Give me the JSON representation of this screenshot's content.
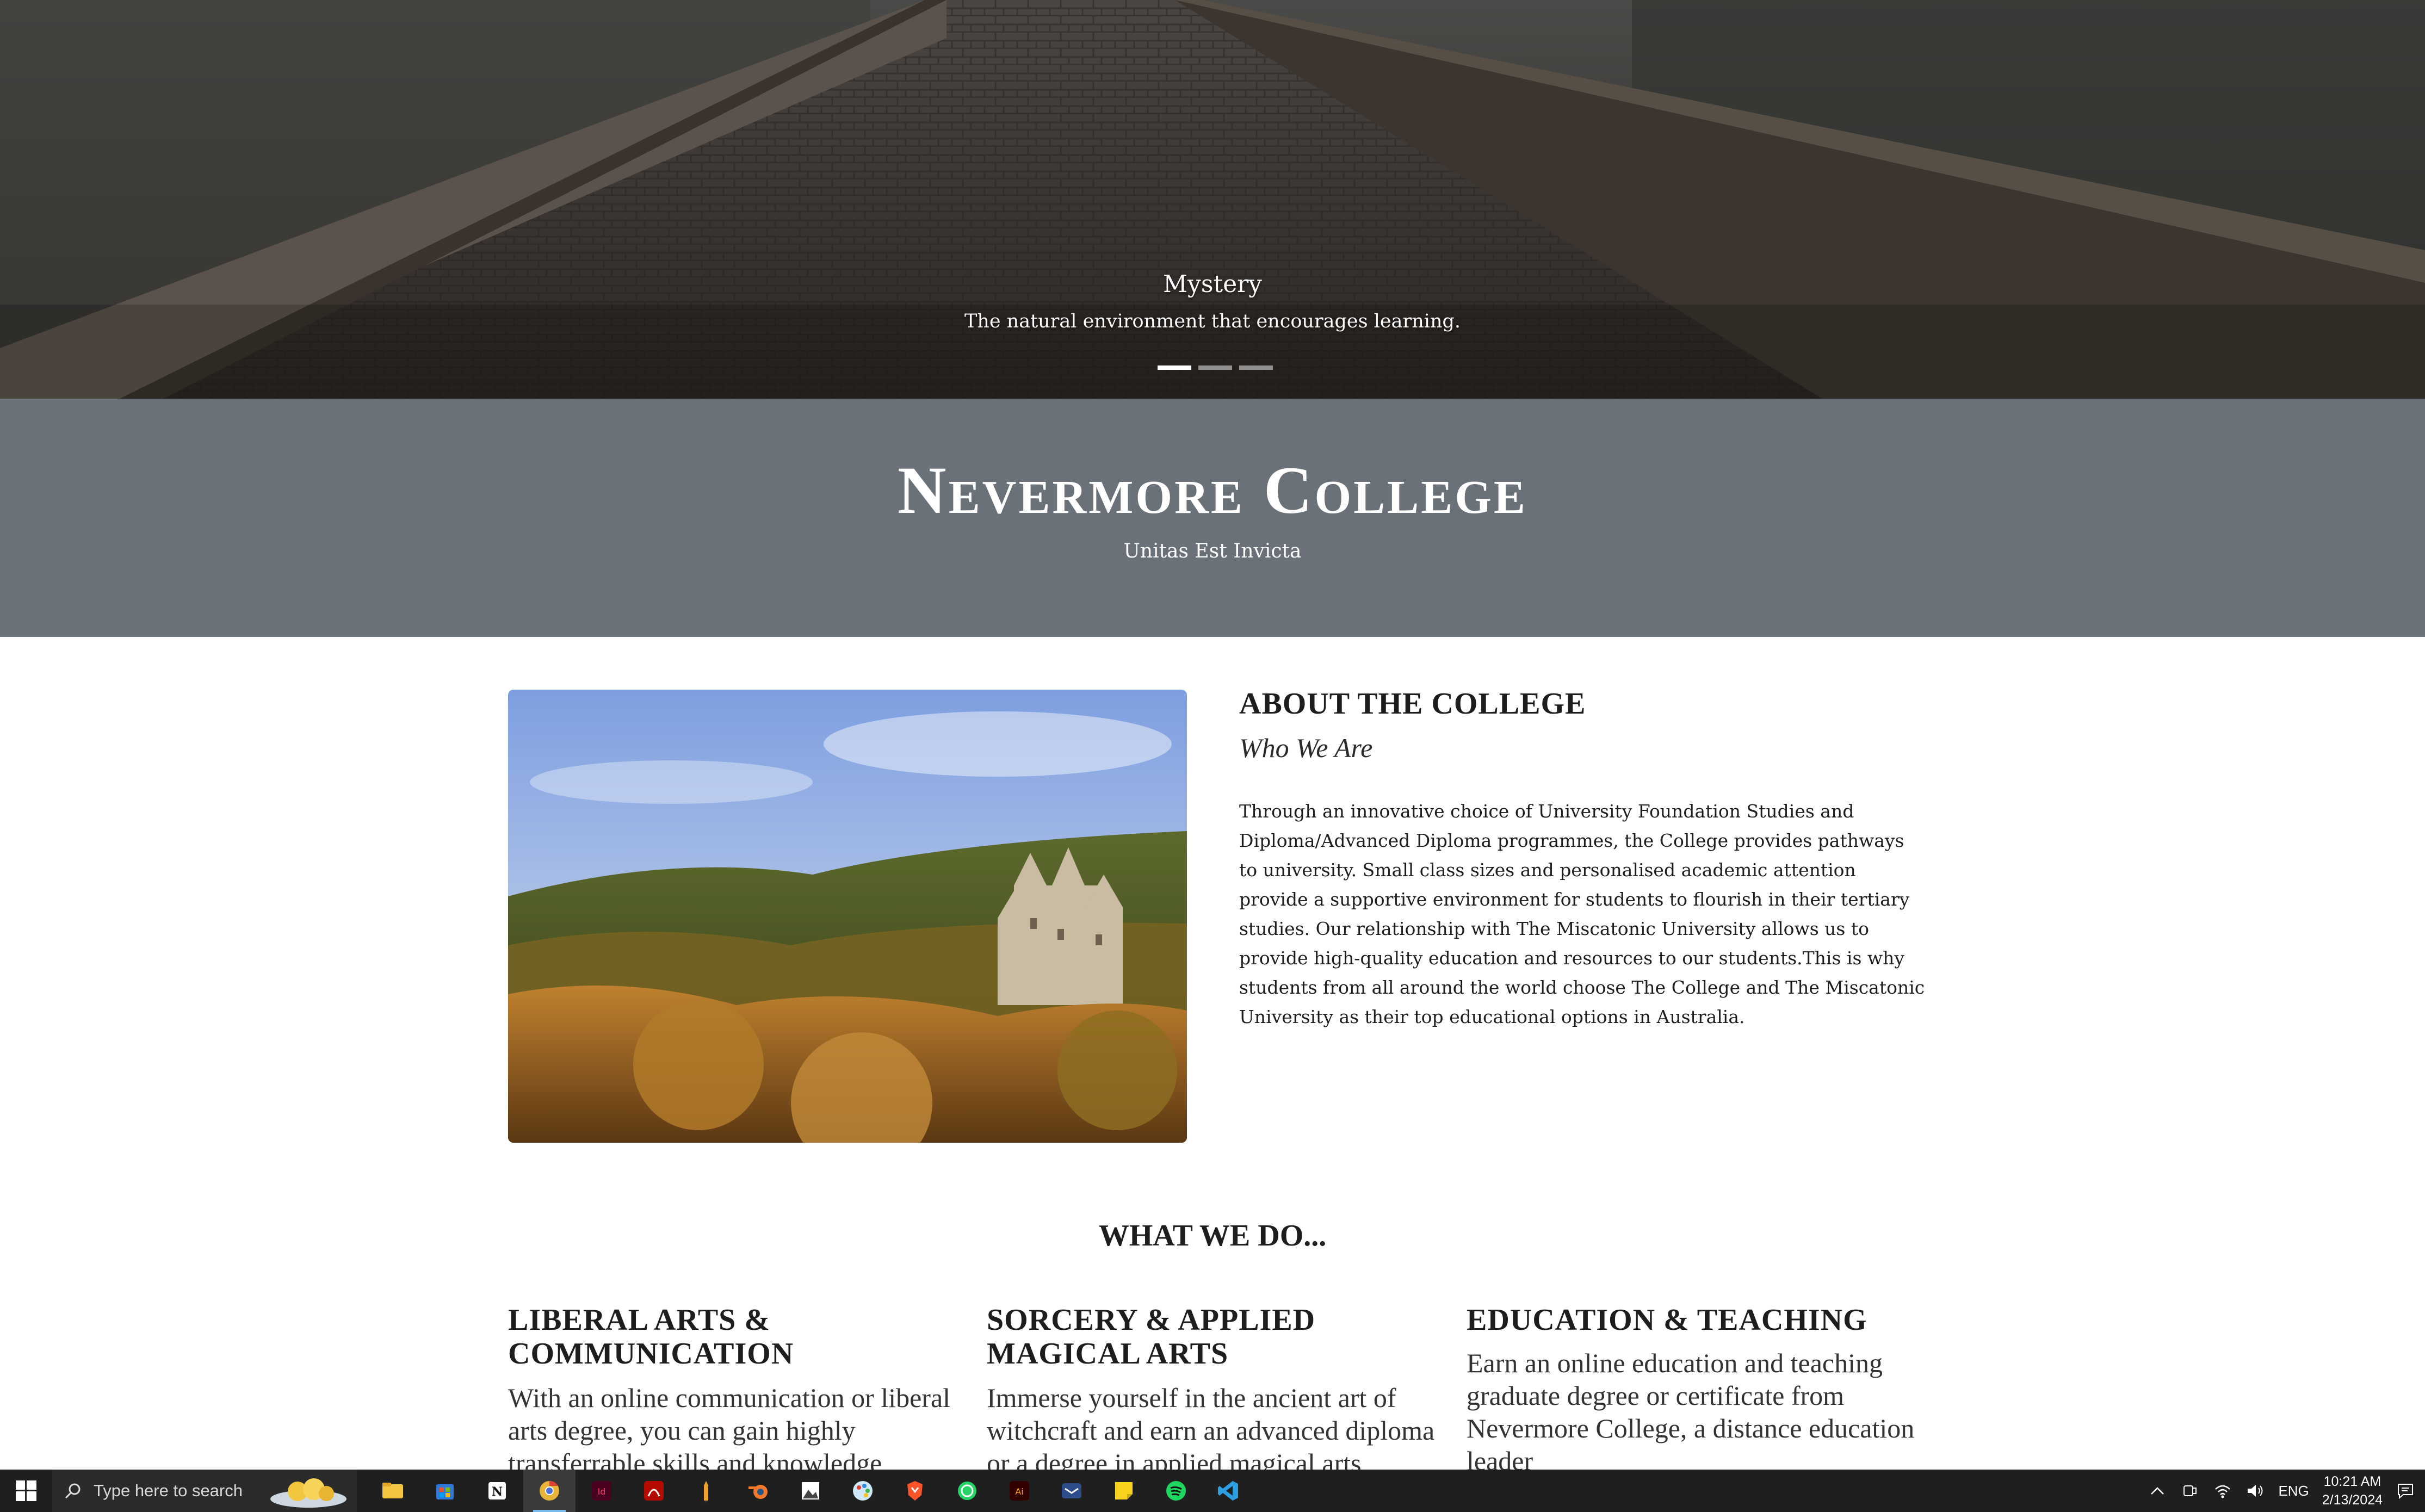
{
  "hero": {
    "title": "Mystery",
    "subtitle": "The natural environment that encourages learning.",
    "active_slide": 1,
    "slide_count": 3
  },
  "band": {
    "college_name": "Nevermore College",
    "motto": "Unitas Est Invicta"
  },
  "about": {
    "heading": "ABOUT THE COLLEGE",
    "subheading": "Who We Are",
    "body": "Through an innovative choice of University Foundation Studies and Diploma/Advanced Diploma programmes, the College provides pathways to university. Small class sizes and personalised academic attention provide a supportive environment for students to flourish in their tertiary studies. Our relationship with The Miscatonic University allows us to provide high-quality education and resources to our students.This is why students from all around the world choose The College and The Miscatonic University as their top educational options in Australia."
  },
  "what_we_do": {
    "heading": "WHAT WE DO...",
    "services": [
      {
        "title": "LIBERAL ARTS & COMMUNICATION",
        "text": "With an online communication or liberal arts degree, you can gain highly transferrable skills and knowledge"
      },
      {
        "title": "SORCERY & APPLIED MAGICAL ARTS",
        "text": "Immerse yourself in the ancient art of witchcraft and earn an advanced diploma or a degree in applied magical arts"
      },
      {
        "title": "EDUCATION & TEACHING",
        "text": "Earn an online education and teaching graduate degree or certificate from Nevermore College, a distance education leader"
      }
    ]
  },
  "taskbar": {
    "search_placeholder": "Type here to search",
    "apps": [
      "file-explorer",
      "microsoft-store",
      "notion",
      "chrome",
      "indesign",
      "acrobat",
      "pencil-app",
      "blender",
      "photo-app",
      "paint-app",
      "brave",
      "whatsapp",
      "illustrator",
      "mail-app",
      "sticky-notes",
      "spotify",
      "vscode"
    ],
    "active_app": "chrome",
    "language": "ENG",
    "time": "10:21 AM",
    "date": "2/13/2024"
  },
  "colors": {
    "band_bg": "#6b7178",
    "taskbar_bg": "#1f1f1f",
    "text_dark": "#1d1d1d"
  }
}
